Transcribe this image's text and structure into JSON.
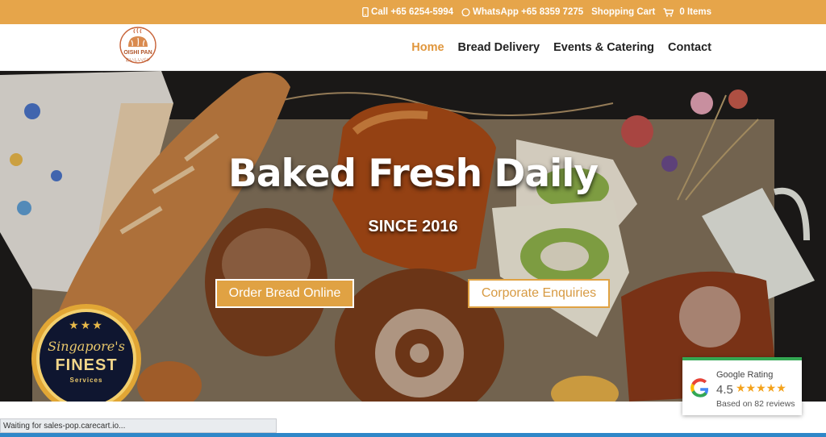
{
  "topbar": {
    "call": "Call +65 6254-5994",
    "whatsapp": "WhatsApp +65 8359 7275",
    "cart": "Shopping Cart",
    "items": "0 Items"
  },
  "logo": {
    "name": "OISHI PAN",
    "subtitle": "おいしいパン"
  },
  "nav": {
    "items": [
      "Home",
      "Bread Delivery",
      "Events & Catering",
      "Contact"
    ]
  },
  "hero": {
    "title": "Baked Fresh Daily",
    "subtitle": "SINCE 2016",
    "order_button": "Order Bread Online",
    "corporate_button": "Corporate Enquiries"
  },
  "badge": {
    "line1": "Singapore's",
    "line2": "FINEST",
    "line3": "Services"
  },
  "google_rating": {
    "title": "Google Rating",
    "score": "4.5",
    "stars": "★★★★★",
    "reviews": "Based on 82 reviews"
  },
  "status": "Waiting for sales-pop.carecart.io...",
  "colors": {
    "accent": "#e6a54a",
    "active_nav": "#e0963c",
    "google_green": "#34a853"
  }
}
